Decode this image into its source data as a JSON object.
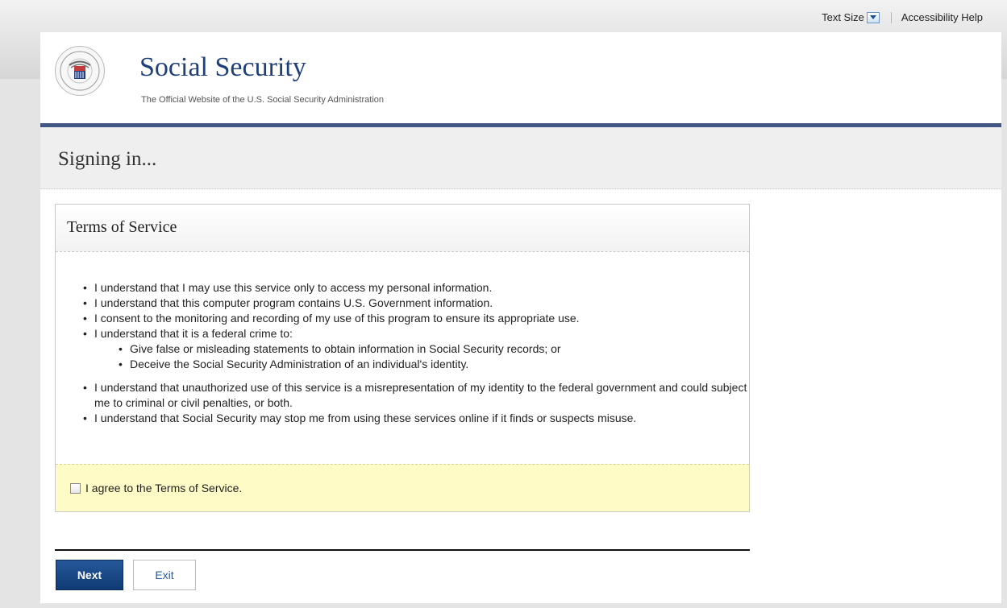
{
  "top_bar": {
    "text_size_label": "Text Size",
    "accessibility_help": "Accessibility Help"
  },
  "header": {
    "title": "Social Security",
    "subtitle": "The Official Website of the U.S. Social Security Administration",
    "seal_text": "SOCIAL SECURITY ADMINISTRATION USA"
  },
  "page": {
    "title": "Signing in..."
  },
  "terms": {
    "title": "Terms of Service",
    "items": [
      "I understand that I may use this service only to access my personal information.",
      "I understand that this computer program contains U.S. Government information.",
      "I consent to the monitoring and recording of my use of this program to ensure its appropriate use.",
      "I understand that it is a federal crime to:",
      "I understand that unauthorized use of this service is a misrepresentation of my identity to the federal government and could subject me to criminal or civil penalties, or both.",
      "I understand that Social Security may stop me from using these services online if it finds or suspects misuse."
    ],
    "sub_items": [
      "Give false or misleading statements to obtain information in Social Security records; or",
      "Deceive the Social Security Administration of an individual's identity."
    ],
    "agree_label": "I agree to the Terms of Service.",
    "agree_checked": false
  },
  "actions": {
    "next_label": "Next",
    "exit_label": "Exit"
  },
  "colors": {
    "brand_blue": "#1f3f78",
    "rule_blue": "#415683",
    "button_blue": "#123f7c",
    "agree_bg": "#fffbc6"
  }
}
